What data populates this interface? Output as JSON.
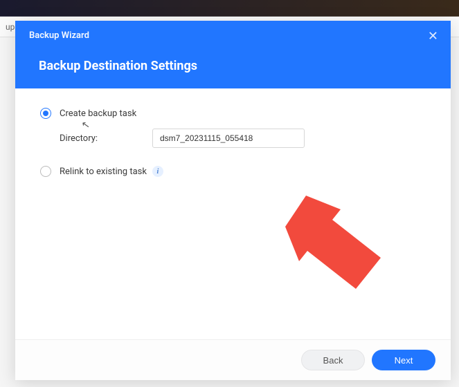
{
  "background": {
    "tab_label": "up"
  },
  "modal": {
    "title": "Backup Wizard",
    "subtitle": "Backup Destination Settings",
    "close_glyph": "✕"
  },
  "options": {
    "create": {
      "label": "Create backup task",
      "selected": true
    },
    "directory": {
      "label": "Directory:",
      "value": "dsm7_20231115_055418"
    },
    "relink": {
      "label": "Relink to existing task",
      "info_glyph": "i"
    }
  },
  "footer": {
    "back": "Back",
    "next": "Next"
  },
  "annotation": {
    "arrow_color": "#f24a3d"
  }
}
